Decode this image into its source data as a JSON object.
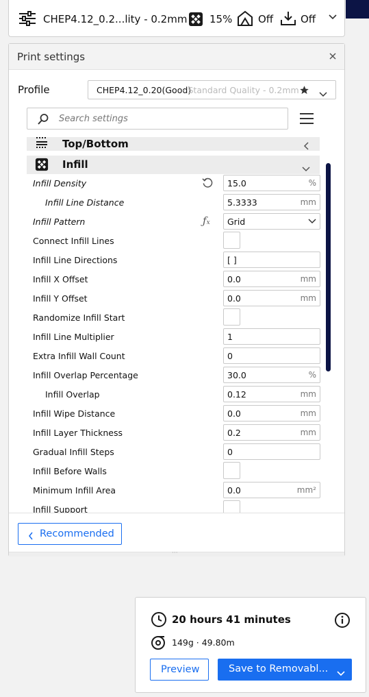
{
  "topbar": {
    "profile_label": "CHEP4.12_0.2...lity - 0.2mm",
    "infill_value": "15%",
    "support_value": "Off",
    "adhesion_value": "Off"
  },
  "panel": {
    "title": "Print settings",
    "profile_label": "Profile",
    "profile_name": "CHEP4.12_0.20(Good)",
    "profile_quality": " - Standard Quality - 0.2mm",
    "search_placeholder": "Search settings",
    "sections": {
      "topbottom": "Top/Bottom",
      "infill": "Infill"
    },
    "settings": [
      {
        "label": "Infill Density",
        "value": "15.0",
        "unit": "%"
      },
      {
        "label": "Infill Line Distance",
        "value": "5.3333",
        "unit": "mm"
      },
      {
        "label": "Infill Pattern",
        "value": "Grid",
        "unit": ""
      },
      {
        "label": "Connect Infill Lines",
        "value": "",
        "unit": ""
      },
      {
        "label": "Infill Line Directions",
        "value": "[ ]",
        "unit": ""
      },
      {
        "label": "Infill X Offset",
        "value": "0.0",
        "unit": "mm"
      },
      {
        "label": "Infill Y Offset",
        "value": "0.0",
        "unit": "mm"
      },
      {
        "label": "Randomize Infill Start",
        "value": "",
        "unit": ""
      },
      {
        "label": "Infill Line Multiplier",
        "value": "1",
        "unit": ""
      },
      {
        "label": "Extra Infill Wall Count",
        "value": "0",
        "unit": ""
      },
      {
        "label": "Infill Overlap Percentage",
        "value": "30.0",
        "unit": "%"
      },
      {
        "label": "Infill Overlap",
        "value": "0.12",
        "unit": "mm"
      },
      {
        "label": "Infill Wipe Distance",
        "value": "0.0",
        "unit": "mm"
      },
      {
        "label": "Infill Layer Thickness",
        "value": "0.2",
        "unit": "mm"
      },
      {
        "label": "Gradual Infill Steps",
        "value": "0",
        "unit": ""
      },
      {
        "label": "Infill Before Walls",
        "value": "",
        "unit": ""
      },
      {
        "label": "Minimum Infill Area",
        "value": "0.0",
        "unit": "mm²"
      },
      {
        "label": "Infill Support",
        "value": "",
        "unit": ""
      }
    ],
    "recommended_button": "Recommended"
  },
  "estimate": {
    "time": "20 hours 41 minutes",
    "material": "149g · 49.80m",
    "preview_button": "Preview",
    "save_button": "Save to Removabl..."
  },
  "colors": {
    "accent": "#196ef0",
    "navy": "#0c1445"
  }
}
